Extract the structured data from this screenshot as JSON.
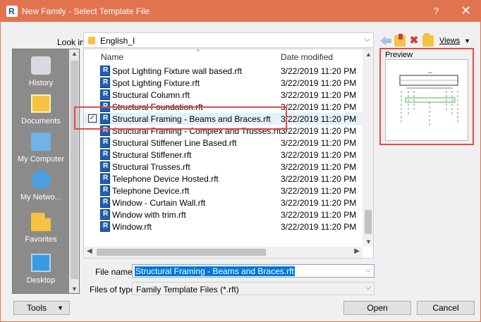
{
  "window": {
    "title": "New Family - Select Template File",
    "help_label": "?",
    "close_label": "✕"
  },
  "lookin": {
    "label": "Look in:",
    "value": "English_I"
  },
  "toolbar": {
    "views_label": "Views"
  },
  "sidebar": {
    "items": [
      {
        "label": "History",
        "icon": "history-icon"
      },
      {
        "label": "Documents",
        "icon": "documents-icon"
      },
      {
        "label": "My Computer",
        "icon": "computer-icon"
      },
      {
        "label": "My Netwo...",
        "icon": "network-icon"
      },
      {
        "label": "Favorites",
        "icon": "favorites-icon"
      },
      {
        "label": "Desktop",
        "icon": "desktop-icon"
      }
    ]
  },
  "filelist": {
    "columns": {
      "name": "Name",
      "date": "Date modified"
    },
    "rows": [
      {
        "name": "Spot Lighting Fixture wall based.rft",
        "date": "3/22/2019 11:20 PM"
      },
      {
        "name": "Spot Lighting Fixture.rft",
        "date": "3/22/2019 11:20 PM"
      },
      {
        "name": "Structural Column.rft",
        "date": "3/22/2019 11:20 PM"
      },
      {
        "name": "Structural Foundation.rft",
        "date": "3/22/2019 11:20 PM"
      },
      {
        "name": "Structural Framing - Beams and Braces.rft",
        "date": "3/22/2019 11:20 PM",
        "selected": true
      },
      {
        "name": "Structural Framing - Complex and Trusses.rft",
        "date": "3/22/2019 11:20 PM"
      },
      {
        "name": "Structural Stiffener Line Based.rft",
        "date": "3/22/2019 11:20 PM"
      },
      {
        "name": "Structural Stiffener.rft",
        "date": "3/22/2019 11:20 PM"
      },
      {
        "name": "Structural Trusses.rft",
        "date": "3/22/2019 11:20 PM"
      },
      {
        "name": "Telephone Device Hosted.rft",
        "date": "3/22/2019 11:20 PM"
      },
      {
        "name": "Telephone Device.rft",
        "date": "3/22/2019 11:20 PM"
      },
      {
        "name": "Window - Curtain Wall.rft",
        "date": "3/22/2019 11:20 PM"
      },
      {
        "name": "Window with trim.rft",
        "date": "3/22/2019 11:20 PM"
      },
      {
        "name": "Window.rft",
        "date": "3/22/2019 11:20 PM"
      }
    ]
  },
  "preview": {
    "label": "Preview"
  },
  "filename": {
    "label": "File name:",
    "value": "Structural Framing - Beams and Braces.rft"
  },
  "filetype": {
    "label": "Files of type:",
    "value": "Family Template Files  (*.rft)"
  },
  "buttons": {
    "tools": "Tools",
    "open": "Open",
    "cancel": "Cancel"
  },
  "colors": {
    "titlebar": "#e2734f",
    "highlight": "#e34a4a",
    "selection": "#0078d7"
  }
}
